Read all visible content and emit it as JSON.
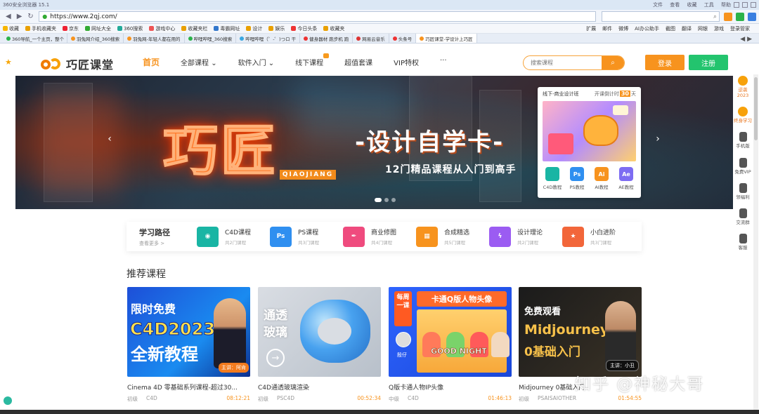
{
  "browser": {
    "window_title": "360安全浏览器 15.1",
    "menus": [
      "文件",
      "查看",
      "收藏",
      "工具",
      "帮助"
    ],
    "url": "https://www.2qj.com/",
    "bookmarks": [
      "收藏",
      "手机收藏夹",
      "京东",
      "网址大全",
      "360搜索",
      "游戏中心",
      "收藏夹栏",
      "毒霸网址",
      "设计",
      "娱乐",
      "今日头条",
      "收藏夹"
    ],
    "bookmarks_right": [
      "扩展",
      "邮件",
      "微博",
      "AI办公助手",
      "截图",
      "翻译",
      "网银",
      "游戏",
      "登录管家"
    ],
    "tabs": [
      "360导航_一个主页，整个",
      "羽兔网介绍_360搜索",
      "羽兔网-年轻人都在用的",
      "哔哩哔哩_360搜索",
      "哔哩哔哩（゜-゜)つロ 干",
      "健身器材 跑步机 跑",
      "网易云音乐",
      "头条号",
      "巧匠课堂-学设计上巧匠"
    ],
    "active_tab_index": 8
  },
  "header": {
    "logo_text": "巧匠课堂",
    "nav": [
      "首页",
      "全部课程",
      "软件入门",
      "线下课程",
      "超值套课",
      "VIP特权",
      "···"
    ],
    "search_placeholder": "搜索课程",
    "login_label": "登录",
    "register_label": "注册"
  },
  "banner": {
    "logo_text": "巧匠",
    "logo_sub": "QIAOJIANG",
    "headline": "-设计自学卡-",
    "tagline": "12门精品课程从入门到高手",
    "slide_count": 3,
    "active_slide": 0,
    "promo": {
      "title": "线下-商业设计班",
      "countdown_prefix": "开课倒计时",
      "countdown_days": "30",
      "countdown_unit": "天",
      "icons": [
        {
          "label": "C4D教程",
          "abbr": "",
          "color": "#19b5a4"
        },
        {
          "label": "PS教程",
          "abbr": "Ps",
          "color": "#2f8ff0"
        },
        {
          "label": "AI教程",
          "abbr": "Ai",
          "color": "#f7931e"
        },
        {
          "label": "AE教程",
          "abbr": "Ae",
          "color": "#7d6cf2"
        }
      ]
    }
  },
  "categories": {
    "path_title": "学习路径",
    "path_sub": "查看更多 >",
    "items": [
      {
        "name": "C4D课程",
        "count": "共2门课程",
        "color": "#19b5a4",
        "abbr": ""
      },
      {
        "name": "PS课程",
        "count": "共3门课程",
        "color": "#2f8ff0",
        "abbr": "Ps"
      },
      {
        "name": "商业修图",
        "count": "共4门课程",
        "color": "#ef4b7e",
        "abbr": ""
      },
      {
        "name": "合成精选",
        "count": "共5门课程",
        "color": "#f7931e",
        "abbr": ""
      },
      {
        "name": "设计理论",
        "count": "共2门课程",
        "color": "#9b5cf2",
        "abbr": ""
      },
      {
        "name": "小白进阶",
        "count": "共3门课程",
        "color": "#f2663a",
        "abbr": ""
      }
    ]
  },
  "section_title": "推荐课程",
  "courses": [
    {
      "title": "Cinema 4D 零基础系列课程-超过30...",
      "level": "初级",
      "software": "C4D",
      "duration": "08:12:21",
      "thumb": {
        "tag": "限时免费",
        "line1": "C4D2023",
        "line2": "全新教程",
        "lecturer": "主讲：阿肯"
      }
    },
    {
      "title": "C4D通透玻璃渲染",
      "level": "初级",
      "software": "PSC4D",
      "duration": "00:52:34",
      "thumb": {
        "word1": "通透",
        "word2": "玻璃"
      }
    },
    {
      "title": "Q版卡通人物IP头像",
      "level": "中级",
      "software": "C4D",
      "duration": "01:46:13",
      "thumb": {
        "side": "每周一课",
        "head": "卡通Q版人物头像",
        "caption": "GOOD NIGHT",
        "lecturer": "殷仔"
      }
    },
    {
      "title": "Midjourney 0基础入门",
      "level": "初级",
      "software": "PSAISAIOTHER",
      "duration": "01:54:55",
      "thumb": {
        "tag": "免费观看",
        "line1": "Midjourney",
        "line2": "0基础入门",
        "lecturer": "主讲：小丑"
      }
    }
  ],
  "floatbar": [
    {
      "label": "逆袭2023",
      "tone": "orange"
    },
    {
      "label": "终身学习",
      "tone": "orange"
    },
    {
      "label": "手机版",
      "tone": "gray"
    },
    {
      "label": "免费VIP",
      "tone": "gray"
    },
    {
      "label": "领福利",
      "tone": "gray"
    },
    {
      "label": "交流群",
      "tone": "gray"
    },
    {
      "label": "客服",
      "tone": "gray"
    }
  ],
  "watermark": "知乎 @神秘大哥",
  "colors": {
    "accent": "#f7931e",
    "register": "#23c46e"
  }
}
